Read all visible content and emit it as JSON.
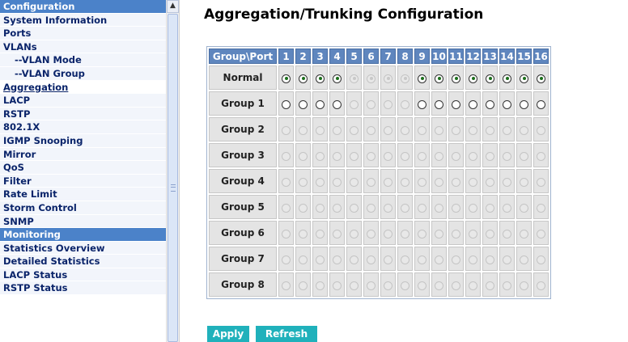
{
  "sidebar": {
    "items": [
      {
        "label": "Configuration",
        "kind": "head"
      },
      {
        "label": "System Information",
        "kind": "item"
      },
      {
        "label": "Ports",
        "kind": "item"
      },
      {
        "label": "VLANs",
        "kind": "item"
      },
      {
        "label": "--VLAN Mode",
        "kind": "sub"
      },
      {
        "label": "--VLAN Group",
        "kind": "sub"
      },
      {
        "label": "Aggregation",
        "kind": "active"
      },
      {
        "label": "LACP",
        "kind": "item"
      },
      {
        "label": "RSTP",
        "kind": "item"
      },
      {
        "label": "802.1X",
        "kind": "item"
      },
      {
        "label": "IGMP Snooping",
        "kind": "item"
      },
      {
        "label": "Mirror",
        "kind": "item"
      },
      {
        "label": "QoS",
        "kind": "item"
      },
      {
        "label": "Filter",
        "kind": "item"
      },
      {
        "label": "Rate Limit",
        "kind": "item"
      },
      {
        "label": "Storm Control",
        "kind": "item"
      },
      {
        "label": "SNMP",
        "kind": "item"
      },
      {
        "label": "Monitoring",
        "kind": "head"
      },
      {
        "label": "Statistics Overview",
        "kind": "item"
      },
      {
        "label": "Detailed Statistics",
        "kind": "item"
      },
      {
        "label": "LACP Status",
        "kind": "item"
      },
      {
        "label": "RSTP Status",
        "kind": "item"
      }
    ],
    "scroll_up_icon": "chevron-up-icon"
  },
  "main": {
    "title": "Aggregation/Trunking Configuration",
    "table": {
      "corner_header": "Group\\Port",
      "ports": [
        "1",
        "2",
        "3",
        "4",
        "5",
        "6",
        "7",
        "8",
        "9",
        "10",
        "11",
        "12",
        "13",
        "14",
        "15",
        "16"
      ],
      "rows": [
        {
          "label": "Normal",
          "states": [
            "checked",
            "checked",
            "checked",
            "checked",
            "disabled-checked",
            "disabled-checked",
            "disabled-checked",
            "disabled-checked",
            "checked",
            "checked",
            "checked",
            "checked",
            "checked",
            "checked",
            "checked",
            "checked"
          ]
        },
        {
          "label": "Group 1",
          "states": [
            "empty",
            "empty",
            "empty",
            "empty",
            "disabled",
            "disabled",
            "disabled",
            "disabled",
            "empty",
            "empty",
            "empty",
            "empty",
            "empty",
            "empty",
            "empty",
            "empty"
          ]
        },
        {
          "label": "Group 2",
          "states": [
            "disabled",
            "disabled",
            "disabled",
            "disabled",
            "disabled",
            "disabled",
            "disabled",
            "disabled",
            "disabled",
            "disabled",
            "disabled",
            "disabled",
            "disabled",
            "disabled",
            "disabled",
            "disabled"
          ]
        },
        {
          "label": "Group 3",
          "states": [
            "disabled",
            "disabled",
            "disabled",
            "disabled",
            "disabled",
            "disabled",
            "disabled",
            "disabled",
            "disabled",
            "disabled",
            "disabled",
            "disabled",
            "disabled",
            "disabled",
            "disabled",
            "disabled"
          ]
        },
        {
          "label": "Group 4",
          "states": [
            "disabled",
            "disabled",
            "disabled",
            "disabled",
            "disabled",
            "disabled",
            "disabled",
            "disabled",
            "disabled",
            "disabled",
            "disabled",
            "disabled",
            "disabled",
            "disabled",
            "disabled",
            "disabled"
          ]
        },
        {
          "label": "Group 5",
          "states": [
            "disabled",
            "disabled",
            "disabled",
            "disabled",
            "disabled",
            "disabled",
            "disabled",
            "disabled",
            "disabled",
            "disabled",
            "disabled",
            "disabled",
            "disabled",
            "disabled",
            "disabled",
            "disabled"
          ]
        },
        {
          "label": "Group 6",
          "states": [
            "disabled",
            "disabled",
            "disabled",
            "disabled",
            "disabled",
            "disabled",
            "disabled",
            "disabled",
            "disabled",
            "disabled",
            "disabled",
            "disabled",
            "disabled",
            "disabled",
            "disabled",
            "disabled"
          ]
        },
        {
          "label": "Group 7",
          "states": [
            "disabled",
            "disabled",
            "disabled",
            "disabled",
            "disabled",
            "disabled",
            "disabled",
            "disabled",
            "disabled",
            "disabled",
            "disabled",
            "disabled",
            "disabled",
            "disabled",
            "disabled",
            "disabled"
          ]
        },
        {
          "label": "Group 8",
          "states": [
            "disabled",
            "disabled",
            "disabled",
            "disabled",
            "disabled",
            "disabled",
            "disabled",
            "disabled",
            "disabled",
            "disabled",
            "disabled",
            "disabled",
            "disabled",
            "disabled",
            "disabled",
            "disabled"
          ]
        }
      ]
    },
    "apply_label": "Apply",
    "refresh_label": "Refresh"
  },
  "colors": {
    "sidebar_header": "#4b82c9",
    "table_header": "#5f86be",
    "button": "#20b1bb",
    "radio_dot": "#1a6e1a"
  }
}
